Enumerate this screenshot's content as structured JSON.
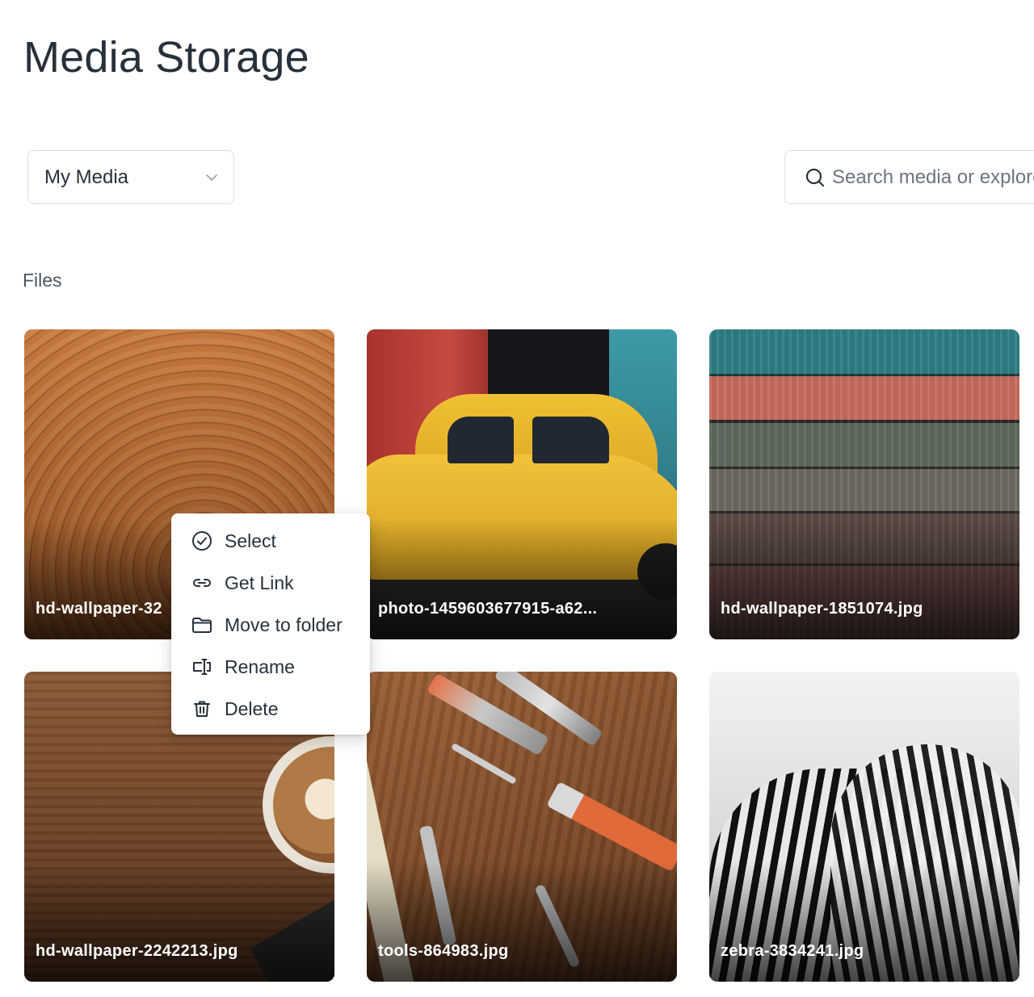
{
  "page": {
    "title": "Media Storage"
  },
  "toolbar": {
    "media_select": {
      "value": "My Media",
      "icon": "chevron-down-icon"
    },
    "search": {
      "placeholder": "Search media or explore",
      "icon": "search-icon"
    }
  },
  "files": {
    "label": "Files",
    "items": [
      {
        "name": "hd-wallpaper-32"
      },
      {
        "name": "photo-1459603677915-a62..."
      },
      {
        "name": "hd-wallpaper-1851074.jpg"
      },
      {
        "name": "hd-wallpaper-2242213.jpg"
      },
      {
        "name": "tools-864983.jpg"
      },
      {
        "name": "zebra-3834241.jpg"
      }
    ]
  },
  "context_menu": {
    "items": [
      {
        "label": "Select",
        "icon": "check-circle-icon"
      },
      {
        "label": "Get Link",
        "icon": "link-icon"
      },
      {
        "label": "Move to folder",
        "icon": "folder-icon"
      },
      {
        "label": "Rename",
        "icon": "rename-icon"
      },
      {
        "label": "Delete",
        "icon": "trash-icon"
      }
    ]
  }
}
